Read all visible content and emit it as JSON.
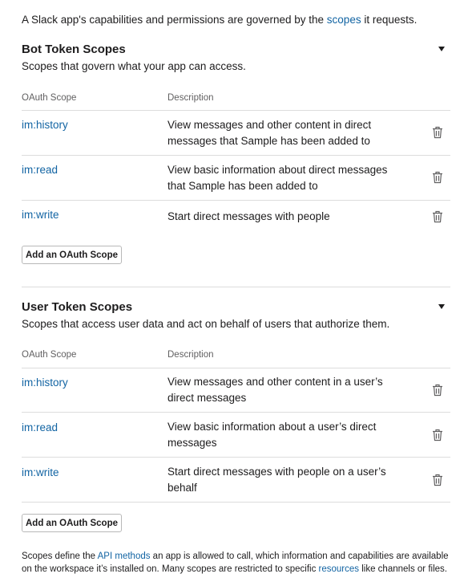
{
  "intro": {
    "before": "A Slack app's capabilities and permissions are governed by the ",
    "link": "scopes",
    "after": " it requests."
  },
  "bot": {
    "title": "Bot Token Scopes",
    "subtitle": "Scopes that govern what your app can access.",
    "col_scope": "OAuth Scope",
    "col_desc": "Description",
    "rows": [
      {
        "scope": "im:history",
        "description": "View messages and other content in direct messages that Sample has been added to"
      },
      {
        "scope": "im:read",
        "description": "View basic information about direct messages that Sample has been added to"
      },
      {
        "scope": "im:write",
        "description": "Start direct messages with people"
      }
    ],
    "add_button": "Add an OAuth Scope"
  },
  "user": {
    "title": "User Token Scopes",
    "subtitle": "Scopes that access user data and act on behalf of users that authorize them.",
    "col_scope": "OAuth Scope",
    "col_desc": "Description",
    "rows": [
      {
        "scope": "im:history",
        "description": "View messages and other content in a user’s direct messages"
      },
      {
        "scope": "im:read",
        "description": "View basic information about a user’s direct messages"
      },
      {
        "scope": "im:write",
        "description": "Start direct messages with people on a user’s behalf"
      }
    ],
    "add_button": "Add an OAuth Scope"
  },
  "footer": {
    "t1": "Scopes define the ",
    "link1": "API methods",
    "t2": " an app is allowed to call, which information and capabilities are available on the workspace it’s installed on. Many scopes are restricted to specific ",
    "link2": "resources",
    "t3": " like channels or files."
  },
  "icons": {
    "collapse": "caret-down-icon",
    "remove": "trash-icon"
  },
  "colors": {
    "link": "#1264a3",
    "text": "#1d1c1d",
    "muted": "#616061",
    "rule": "#dddddd"
  }
}
